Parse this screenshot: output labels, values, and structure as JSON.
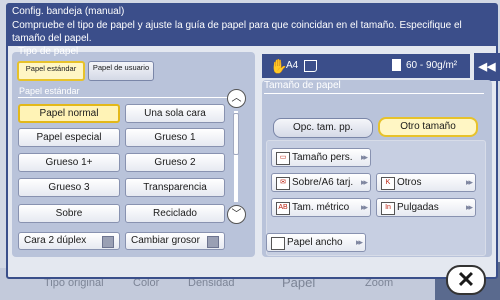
{
  "title": "Config. bandeja (manual)",
  "message": "Compruebe el tipo de papel y ajuste la guía de papel para que coincidan en el tamaño. Especifique el tamaño del papel.",
  "paper_type": {
    "label": "Tipo de papel",
    "tabs": [
      {
        "label": "Papel estándar",
        "selected": true
      },
      {
        "label": "Papel de usuario",
        "selected": false
      }
    ],
    "section_label": "Papel estándar",
    "options": [
      {
        "label": "Papel normal",
        "selected": true
      },
      {
        "label": "Una sola cara",
        "selected": false
      },
      {
        "label": "Papel especial",
        "selected": false
      },
      {
        "label": "Grueso 1",
        "selected": false
      },
      {
        "label": "Grueso 1+",
        "selected": false
      },
      {
        "label": "Grueso 2",
        "selected": false
      },
      {
        "label": "Grueso 3",
        "selected": false
      },
      {
        "label": "Transparencia",
        "selected": false
      },
      {
        "label": "Sobre",
        "selected": false
      },
      {
        "label": "Reciclado",
        "selected": false
      }
    ],
    "checkboxes": [
      {
        "label": "Cara 2 dúplex",
        "checked": false
      },
      {
        "label": "Cambiar grosor",
        "checked": false
      }
    ]
  },
  "status": {
    "size": "A4",
    "weight": "60 - 90g/m²"
  },
  "paper_size": {
    "label": "Tamaño de papel",
    "tabs": [
      {
        "label": "Opc. tam. pp.",
        "selected": false
      },
      {
        "label": "Otro tamaño",
        "selected": true
      }
    ],
    "options": [
      {
        "label": "Tamaño pers.",
        "icon": "custom-size-icon"
      },
      {
        "label": "Sobre/A6 tarj.",
        "icon": "envelope-icon"
      },
      {
        "label": "Otros",
        "icon": "other-size-icon"
      },
      {
        "label": "Tam. métrico",
        "icon": "metric-size-icon"
      },
      {
        "label": "Pulgadas",
        "icon": "inch-size-icon"
      },
      {
        "label": "Papel ancho",
        "icon": "wide-paper-icon"
      }
    ]
  },
  "background_footer": [
    "Tipo original",
    "Color",
    "Densidad",
    "Papel",
    "Zoom"
  ],
  "colors": {
    "accent": "#3b4e8a",
    "selected": "#fff3b6",
    "panel": "#b9c3da"
  }
}
